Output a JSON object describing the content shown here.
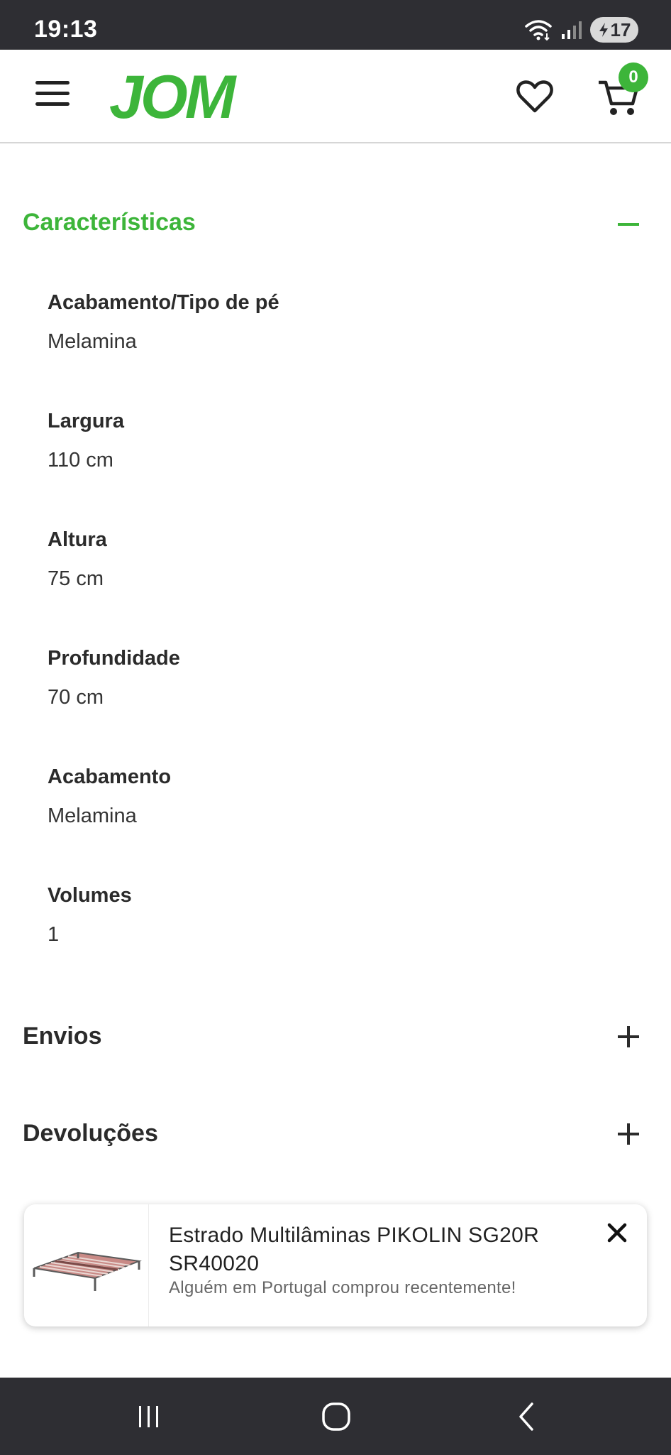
{
  "status_bar": {
    "time": "19:13",
    "battery": "17",
    "icons": [
      "wifi-icon",
      "signal-icon",
      "battery-icon"
    ]
  },
  "header": {
    "logo": "JOM",
    "cart_count": "0",
    "brand_color": "#3db53a",
    "icons": [
      "menu-icon",
      "heart-icon",
      "cart-icon"
    ]
  },
  "characteristics": {
    "title": "Características",
    "specs": [
      {
        "label": "Acabamento/Tipo de pé",
        "value": "Melamina"
      },
      {
        "label": "Largura",
        "value": "110 cm"
      },
      {
        "label": "Altura",
        "value": "75 cm"
      },
      {
        "label": "Profundidade",
        "value": "70 cm"
      },
      {
        "label": "Acabamento",
        "value": "Melamina"
      },
      {
        "label": "Volumes",
        "value": "1"
      }
    ]
  },
  "sections": {
    "shipping": "Envios",
    "returns": "Devoluções"
  },
  "toast": {
    "title": "Estrado Multilâminas PIKOLIN SG20R SR40020",
    "subtitle": "Alguém em Portugal comprou recentemente!"
  },
  "nav": {
    "icons": [
      "recent-apps-icon",
      "home-icon",
      "back-icon"
    ]
  }
}
